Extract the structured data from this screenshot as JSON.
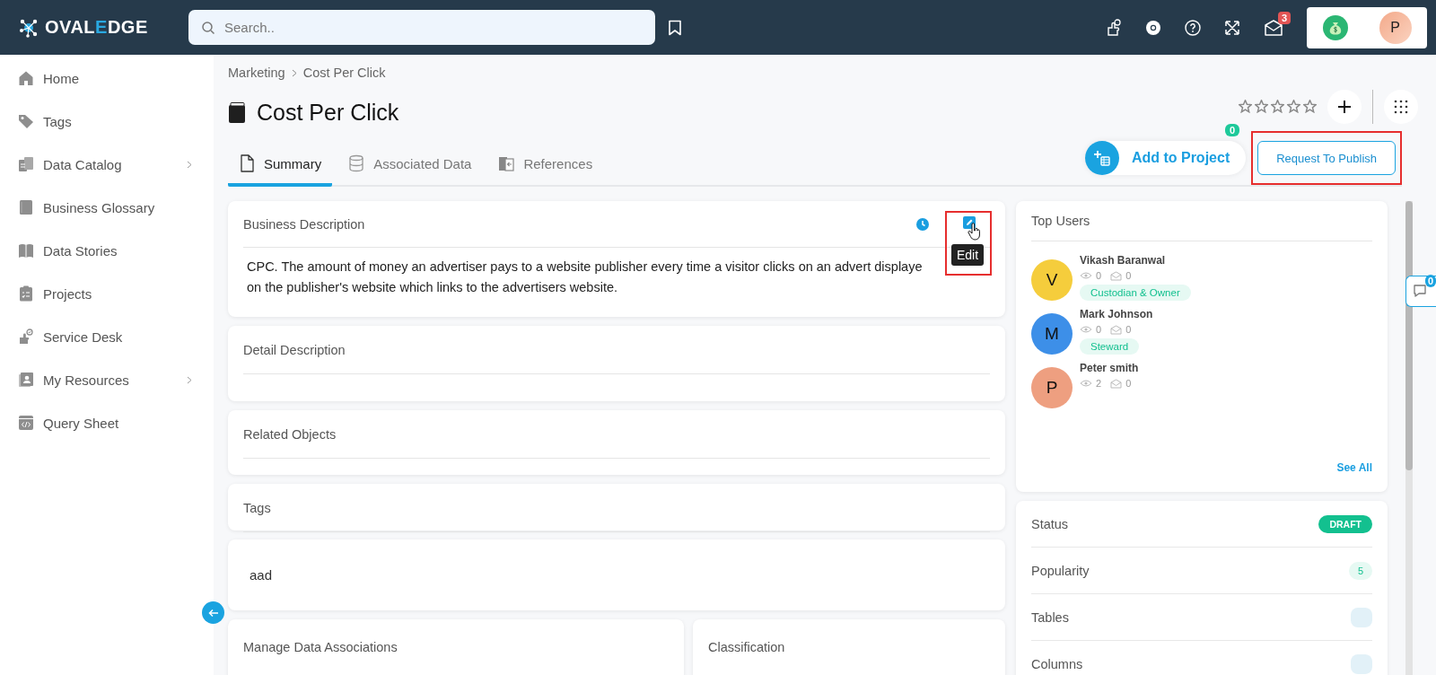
{
  "header": {
    "logo": {
      "before": "OVAL",
      "accent": "E",
      "after": "DGE"
    },
    "search": {
      "placeholder": "Search.."
    },
    "mail_count": "3",
    "avatar": "P"
  },
  "sidebar": {
    "items": [
      {
        "label": "Home",
        "has_submenu": false
      },
      {
        "label": "Tags",
        "has_submenu": false
      },
      {
        "label": "Data Catalog",
        "has_submenu": true
      },
      {
        "label": "Business Glossary",
        "has_submenu": false
      },
      {
        "label": "Data Stories",
        "has_submenu": false
      },
      {
        "label": "Projects",
        "has_submenu": false
      },
      {
        "label": "Service Desk",
        "has_submenu": false
      },
      {
        "label": "My Resources",
        "has_submenu": true
      },
      {
        "label": "Query Sheet",
        "has_submenu": false
      }
    ]
  },
  "breadcrumb": [
    "Marketing",
    "Cost Per Click"
  ],
  "title": "Cost Per Click",
  "rating": {
    "stars": 0
  },
  "tabs": [
    {
      "label": "Summary",
      "selected": true
    },
    {
      "label": "Associated Data",
      "selected": false
    },
    {
      "label": "References",
      "selected": false
    }
  ],
  "add_to_project": {
    "label": "Add to Project",
    "count": "0"
  },
  "request_button": {
    "label": "Request To Publish",
    "highlighted": true
  },
  "business_description": {
    "title": "Business Description",
    "text": "CPC. The amount of money an advertiser pays to a website publisher every time a visitor clicks on an advert displaye\non the publisher's website which links to the advertisers website.",
    "edit_tooltip": "Edit",
    "edit_highlighted": true
  },
  "sections": [
    {
      "title": "Detail Description"
    },
    {
      "title": "Related Objects"
    },
    {
      "title": "Tags"
    }
  ],
  "tag_card": {
    "text": "aad"
  },
  "bottom_cards": [
    {
      "title": "Manage Data Associations"
    },
    {
      "title": "Classification"
    }
  ],
  "top_users": {
    "title": "Top Users",
    "users": [
      {
        "initial": "V",
        "name": "Vikash Baranwal",
        "views": "0",
        "messages": "0",
        "role": "Custodian & Owner",
        "color": "#f5cd3c"
      },
      {
        "initial": "M",
        "name": "Mark Johnson",
        "views": "0",
        "messages": "0",
        "role": "Steward",
        "color": "#3d8fe8"
      },
      {
        "initial": "P",
        "name": "Peter smith",
        "views": "2",
        "messages": "0",
        "color": "#ee9f80"
      }
    ],
    "see_all": "See All"
  },
  "properties": [
    {
      "label": "Status",
      "kind": "status",
      "value": "DRAFT"
    },
    {
      "label": "Popularity",
      "kind": "count",
      "value": "5"
    },
    {
      "label": "Tables",
      "kind": "empty"
    },
    {
      "label": "Columns",
      "kind": "empty"
    }
  ],
  "comments": {
    "count": "0"
  }
}
